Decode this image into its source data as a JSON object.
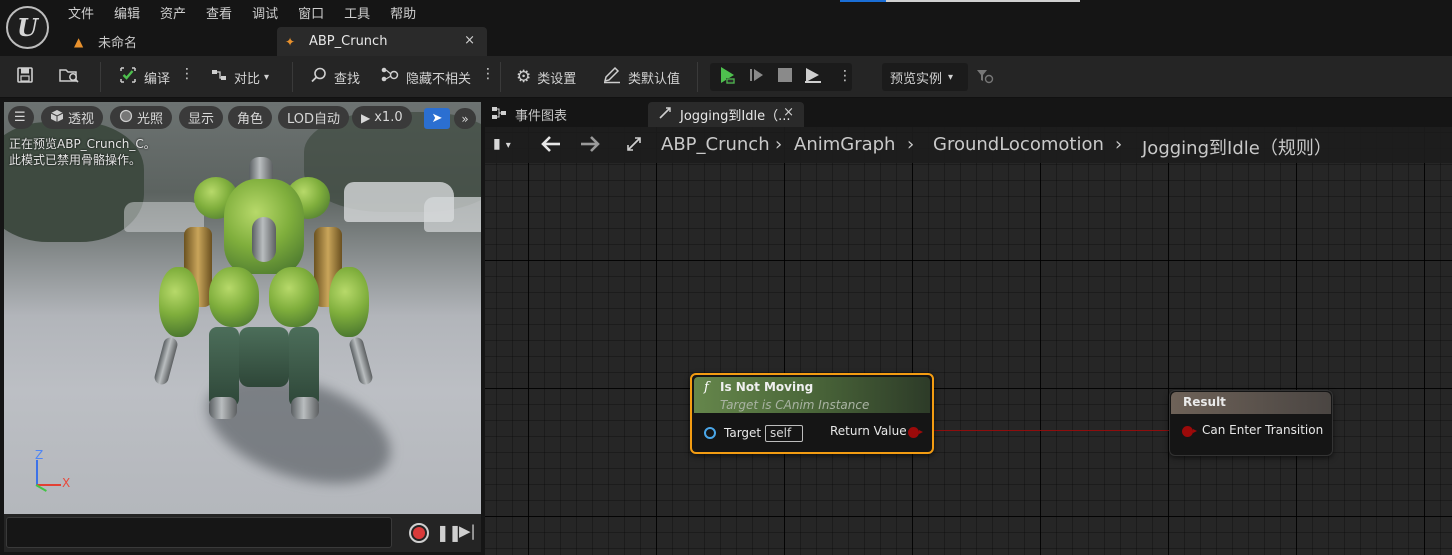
{
  "menu": {
    "items": [
      "文件",
      "编辑",
      "资产",
      "查看",
      "调试",
      "窗口",
      "工具",
      "帮助"
    ]
  },
  "doc_tabs": {
    "unnamed": "未命名",
    "asset": "ABP_Crunch",
    "close_glyph": "×"
  },
  "toolbar": {
    "compile": "编译",
    "diff": "对比",
    "find": "查找",
    "hide_unrelated": "隐藏不相关",
    "class_settings": "类设置",
    "class_defaults": "类默认值",
    "preview_instance": "预览实例"
  },
  "viewport": {
    "perspective": "透视",
    "lighting": "光照",
    "show": "显示",
    "character": "角色",
    "lod": "LOD自动",
    "speed": "x1.0",
    "message_line1": "正在预览ABP_Crunch_C。",
    "message_line2": "此模式已禁用骨骼操作。",
    "axis_z": "Z",
    "axis_x": "X"
  },
  "graph_tabs": {
    "event_graph": "事件图表",
    "rule_tab": "Jogging到Idle（...",
    "close_glyph": "×"
  },
  "breadcrumb": {
    "items": [
      "ABP_Crunch",
      "AnimGraph",
      "GroundLocomotion",
      "Jogging到Idle（规则）"
    ]
  },
  "nodes": {
    "func": {
      "title": "Is Not Moving",
      "subtitle": "Target is CAnim Instance",
      "target_label": "Target",
      "target_value": "self",
      "return_label": "Return Value"
    },
    "result": {
      "title": "Result",
      "pin_label": "Can Enter Transition"
    }
  },
  "colors": {
    "accent_blue": "#2b6fd1",
    "selected_node_outline": "#f39c12",
    "bool_pin": "#9c0a0a",
    "play_green": "#4ec04e"
  }
}
